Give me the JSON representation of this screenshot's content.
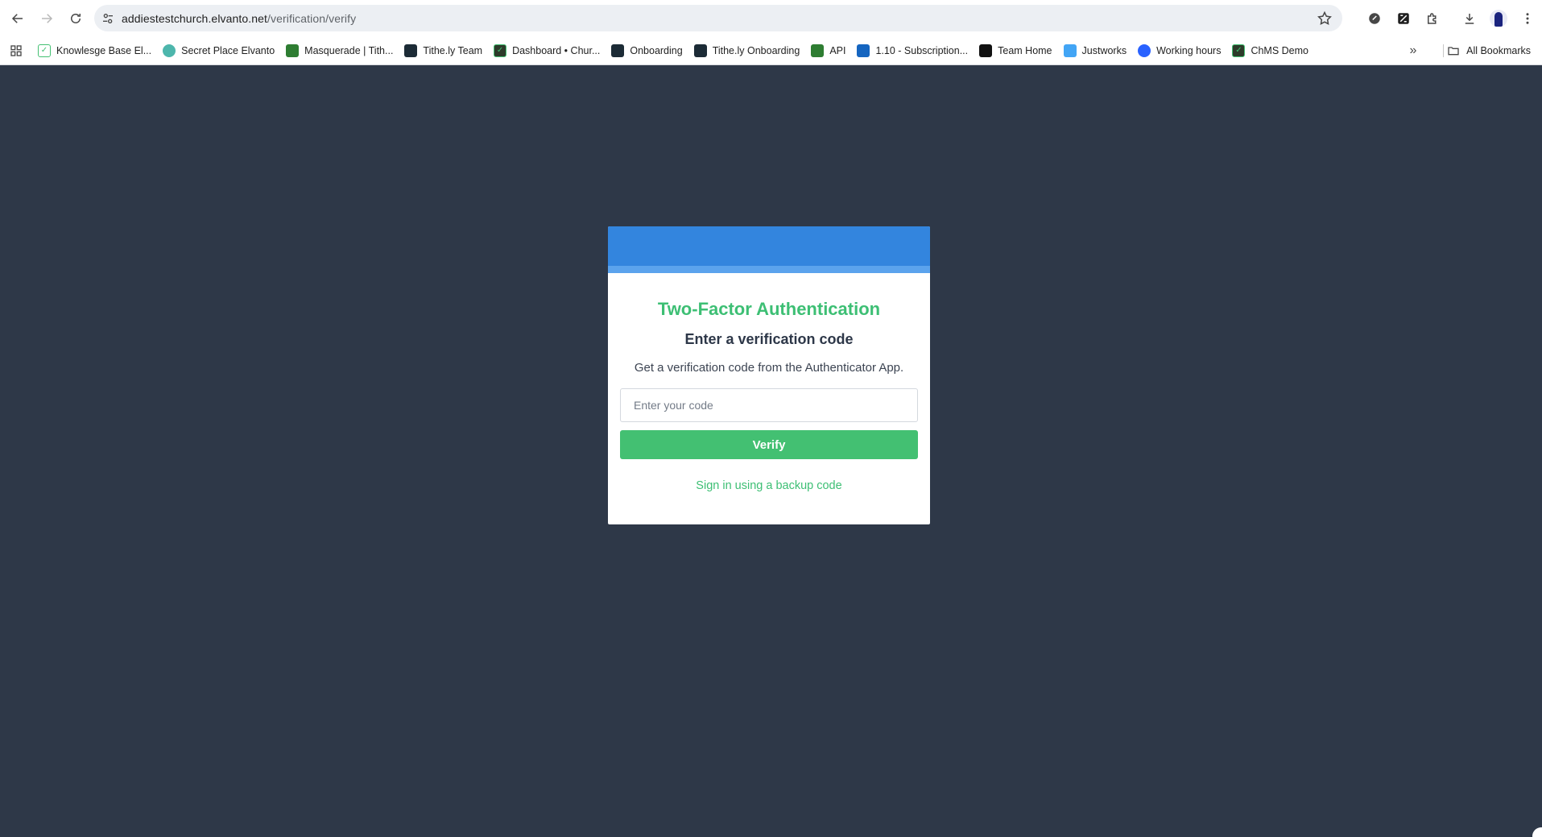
{
  "browser": {
    "url_host": "addiestestchurch.elvanto.net",
    "url_path": "/verification/verify",
    "bookmarks": [
      {
        "label": "Knowlesge Base El...",
        "icon": "elvanto-check-icon",
        "color": "#ffffff"
      },
      {
        "label": "Secret Place Elvanto",
        "icon": "smiley-icon",
        "color": "#4db6ac"
      },
      {
        "label": "Masquerade | Tith...",
        "icon": "tithely-green-icon",
        "color": "#2e7d32"
      },
      {
        "label": "Tithe.ly Team",
        "icon": "tithely-dark-icon",
        "color": "#1c2b36"
      },
      {
        "label": "Dashboard • Chur...",
        "icon": "elvanto-check-icon",
        "color": "#2d3b2a"
      },
      {
        "label": "Onboarding",
        "icon": "tithely-dark-icon",
        "color": "#1c2b36"
      },
      {
        "label": "Tithe.ly Onboarding",
        "icon": "tithely-dark-icon",
        "color": "#1c2b36"
      },
      {
        "label": "API",
        "icon": "tithely-green-icon",
        "color": "#2e7d32"
      },
      {
        "label": "1.10 - Subscription...",
        "icon": "confluence-icon",
        "color": "#1565c0"
      },
      {
        "label": "Team Home",
        "icon": "tithely-black-icon",
        "color": "#111111"
      },
      {
        "label": "Justworks",
        "icon": "justworks-icon",
        "color": "#42a5f5"
      },
      {
        "label": "Working hours",
        "icon": "globe-icon",
        "color": "#2962ff"
      },
      {
        "label": "ChMS Demo",
        "icon": "elvanto-check-icon",
        "color": "#2d3b2a"
      }
    ],
    "all_bookmarks_label": "All Bookmarks"
  },
  "page": {
    "title": "Two-Factor Authentication",
    "subtitle": "Enter a verification code",
    "description": "Get a verification code from the Authenticator App.",
    "code_placeholder": "Enter your code",
    "code_value": "",
    "verify_label": "Verify",
    "backup_link": "Sign in using a backup code"
  },
  "colors": {
    "background": "#2e3848",
    "header_blue": "#3385de",
    "accent_green": "#3dbf74",
    "button_green": "#43c072"
  }
}
